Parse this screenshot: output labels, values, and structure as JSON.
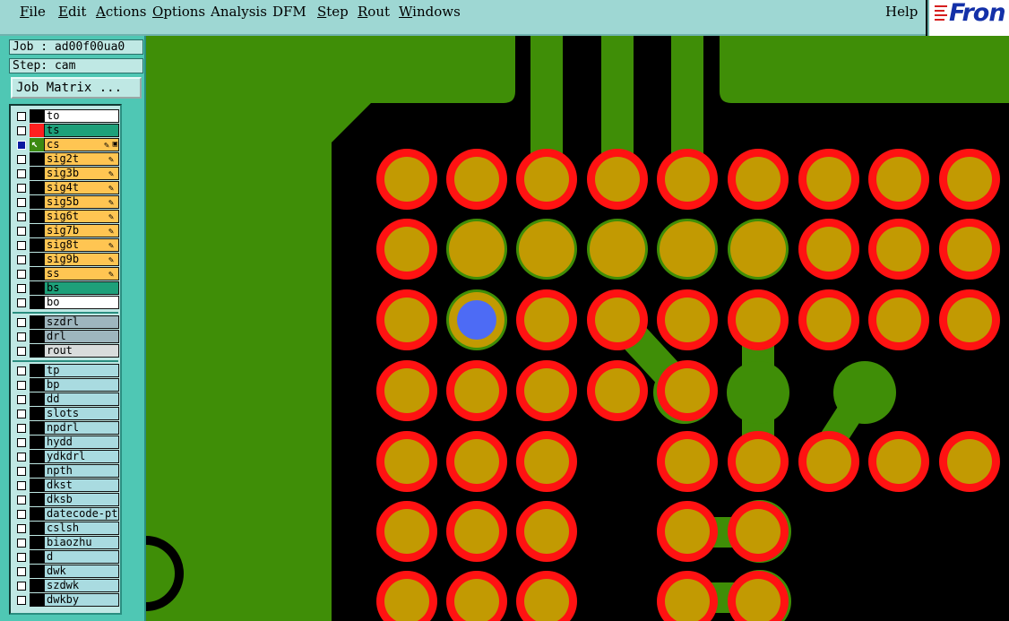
{
  "menu": [
    {
      "label": "File",
      "underline": "F",
      "rest": "ile"
    },
    {
      "label": "Edit",
      "underline": "E",
      "rest": "dit"
    },
    {
      "label": "Actions",
      "underline": "A",
      "rest": "ctions"
    },
    {
      "label": "Options",
      "underline": "O",
      "rest": "ptions"
    },
    {
      "label": "Analysis",
      "underline": "",
      "rest": "Analysis"
    },
    {
      "label": "DFM",
      "underline": "",
      "rest": "DFM"
    },
    {
      "label": "Step",
      "underline": "S",
      "rest": "tep"
    },
    {
      "label": "Rout",
      "underline": "R",
      "rest": "out"
    },
    {
      "label": "Windows",
      "underline": "W",
      "rest": "indows"
    }
  ],
  "help_label": "Help",
  "logo_text": "Fron",
  "job_label": "Job : ad00f00ua0",
  "step_label": "Step: cam",
  "job_matrix_label": "Job Matrix ...",
  "layers_group1": [
    {
      "name": "to",
      "bg": "#ffffff",
      "color": "#000000"
    },
    {
      "name": "ts",
      "bg": "#1ea07a",
      "color": "#ff2020"
    },
    {
      "name": "cs",
      "bg": "#ffc552",
      "color": "#000000",
      "active": true
    },
    {
      "name": "sig2t",
      "bg": "#ffc552",
      "color": "#000000"
    },
    {
      "name": "sig3b",
      "bg": "#ffc552",
      "color": "#000000"
    },
    {
      "name": "sig4t",
      "bg": "#ffc552",
      "color": "#000000"
    },
    {
      "name": "sig5b",
      "bg": "#ffc552",
      "color": "#000000"
    },
    {
      "name": "sig6t",
      "bg": "#ffc552",
      "color": "#000000"
    },
    {
      "name": "sig7b",
      "bg": "#ffc552",
      "color": "#000000"
    },
    {
      "name": "sig8t",
      "bg": "#ffc552",
      "color": "#000000"
    },
    {
      "name": "sig9b",
      "bg": "#ffc552",
      "color": "#000000"
    },
    {
      "name": "ss",
      "bg": "#ffc552",
      "color": "#000000"
    },
    {
      "name": "bs",
      "bg": "#1ea07a",
      "color": "#000000"
    },
    {
      "name": "bo",
      "bg": "#ffffff",
      "color": "#000000"
    }
  ],
  "layers_group2": [
    {
      "name": "szdrl",
      "bg": "#9eb6be"
    },
    {
      "name": "drl",
      "bg": "#9eb6be"
    },
    {
      "name": "rout",
      "bg": "#d9dcdc"
    }
  ],
  "layers_group3": [
    {
      "name": "tp"
    },
    {
      "name": "bp"
    },
    {
      "name": "dd"
    },
    {
      "name": "slots"
    },
    {
      "name": "npdrl"
    },
    {
      "name": "hydd"
    },
    {
      "name": "ydkdrl"
    },
    {
      "name": "npth"
    },
    {
      "name": "dkst"
    },
    {
      "name": "dksb"
    },
    {
      "name": "datecode-pte"
    },
    {
      "name": "cslsh"
    },
    {
      "name": "biaozhu"
    },
    {
      "name": "d"
    },
    {
      "name": "dwk"
    },
    {
      "name": "szdwk"
    },
    {
      "name": "dwkby"
    }
  ],
  "colors": {
    "copper": "#3f8e07",
    "pad_ring": "#ff1212",
    "pad_fill": "#c29a02",
    "selected_pad": "#4d6bf5",
    "background": "#000000"
  }
}
